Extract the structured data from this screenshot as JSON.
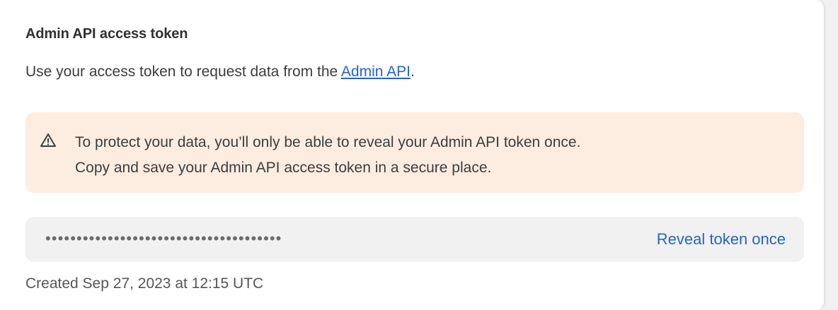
{
  "card": {
    "title": "Admin API access token",
    "description_prefix": "Use your access token to request data from the ",
    "description_link": "Admin API",
    "description_suffix": "."
  },
  "warning": {
    "icon": "warning-triangle-icon",
    "line1": "To protect your data, you’ll only be able to reveal your Admin API token once.",
    "line2": "Copy and save your Admin API access token in a secure place."
  },
  "token": {
    "masked_value": "••••••••••••••••••••••••••••••••••••••",
    "reveal_label": "Reveal token once"
  },
  "meta": {
    "created": "Created Sep 27, 2023 at 12:15 UTC"
  },
  "colors": {
    "link": "#2463d1",
    "warning_bg": "#fdede0",
    "token_bg": "#f1f1f1"
  }
}
